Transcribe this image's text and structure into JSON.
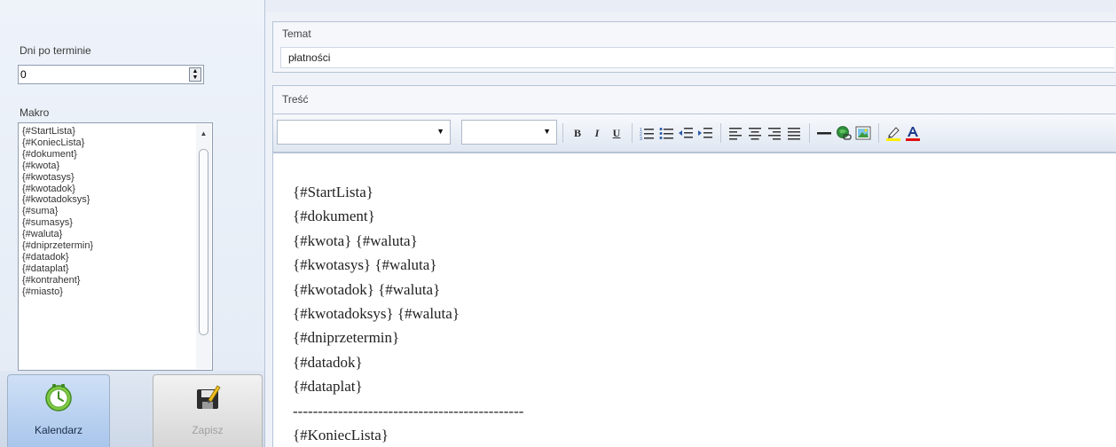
{
  "left": {
    "days_label": "Dni po terminie",
    "days_value": "0",
    "macro_label": "Makro",
    "macros": [
      "{#StartLista}",
      "{#KoniecLista}",
      "{#dokument}",
      "{#kwota}",
      "{#kwotasys}",
      "{#kwotadok}",
      "{#kwotadoksys}",
      "{#suma}",
      "{#sumasys}",
      "{#waluta}",
      "{#dniprzetermin}",
      "{#datadok}",
      "{#dataplat}",
      "{#kontrahent}",
      "{#miasto}"
    ],
    "buttons": {
      "calendar_label": "Kalendarz",
      "save_label": "Zapisz"
    }
  },
  "subject": {
    "label": "Temat",
    "value": "płatności"
  },
  "content": {
    "label": "Treść",
    "font_value": "",
    "size_value": "",
    "toolbar_icons": [
      "bold-icon",
      "italic-icon",
      "underline-icon",
      "numbered-list-icon",
      "bullet-list-icon",
      "outdent-icon",
      "indent-icon",
      "align-left-icon",
      "align-center-icon",
      "align-right-icon",
      "justify-icon",
      "horizontal-line-icon",
      "hyperlink-icon",
      "insert-image-icon",
      "highlight-icon",
      "font-color-icon"
    ],
    "toolbar_glyphs": {
      "bold": "B",
      "italic": "I",
      "underline": "U"
    },
    "lines": [
      "{#StartLista}",
      "{#dokument}",
      "{#kwota} {#waluta}",
      "{#kwotasys} {#waluta}",
      "{#kwotadok} {#waluta}",
      "{#kwotadoksys} {#waluta}",
      "{#dniprzetermin}",
      "{#datadok}",
      "{#dataplat}",
      "----------------------------------------------",
      "{#KoniecLista}"
    ]
  },
  "colors": {
    "highlight_bar": "#ffee00",
    "font_color_bar": "#e01010",
    "accent_blue": "#a9c6ec"
  }
}
